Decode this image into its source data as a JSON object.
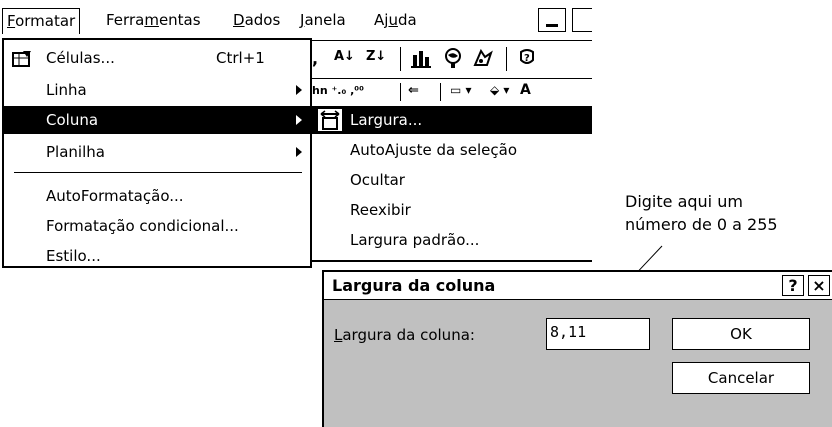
{
  "menubar": {
    "formatar": "Formatar",
    "ferramentas": "Ferramentas",
    "dados": "Dados",
    "janela": "Janela",
    "ajuda": "Ajuda"
  },
  "format_menu": {
    "items": [
      {
        "label": "Células...",
        "shortcut": "Ctrl+1",
        "icon": "format-cells-icon"
      },
      {
        "label": "Linha",
        "submenu": true
      },
      {
        "label": "Coluna",
        "submenu": true,
        "selected": true
      },
      {
        "label": "Planilha",
        "submenu": true
      },
      {
        "label": "AutoFormatação..."
      },
      {
        "label": "Formatação condicional..."
      },
      {
        "label": "Estilo..."
      }
    ]
  },
  "coluna_submenu": {
    "items": [
      {
        "label": "Largura...",
        "selected": true,
        "icon": "column-width-icon"
      },
      {
        "label": "AutoAjuste da seleção"
      },
      {
        "label": "Ocultar"
      },
      {
        "label": "Reexibir"
      },
      {
        "label": "Largura padrão..."
      }
    ]
  },
  "callout": {
    "line1": "Digite aqui um",
    "line2": "número de 0 a 255"
  },
  "dialog": {
    "title": "Largura da coluna",
    "help_button": "?",
    "close_button": "×",
    "field_label": "Largura da coluna:",
    "field_value": "8,11",
    "ok_label": "OK",
    "cancel_label": "Cancelar"
  }
}
